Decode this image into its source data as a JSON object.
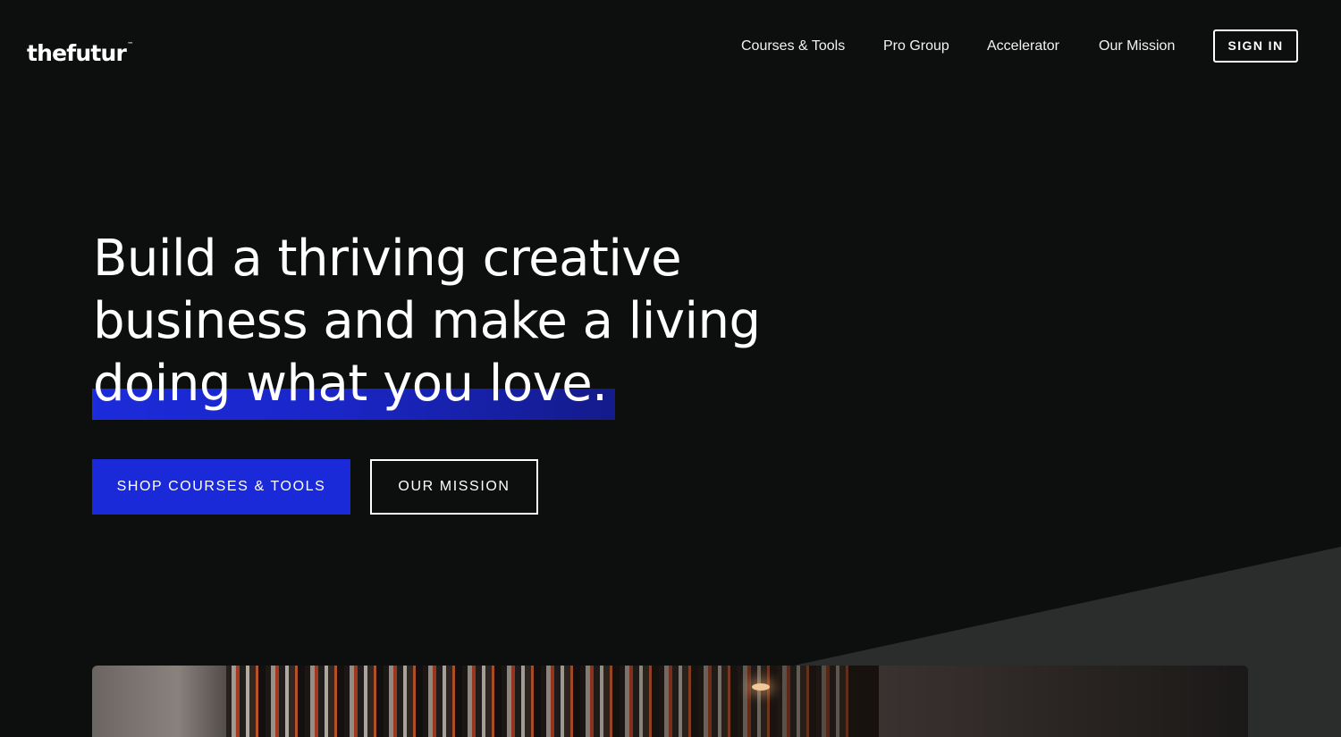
{
  "header": {
    "logo_text": "thefutur",
    "logo_mark": "™",
    "nav": [
      {
        "label": "Courses & Tools"
      },
      {
        "label": "Pro Group"
      },
      {
        "label": "Accelerator"
      },
      {
        "label": "Our Mission"
      }
    ],
    "sign_in_label": "SIGN IN"
  },
  "hero": {
    "headline_lines": [
      "Build a thriving creative",
      "business and make a living",
      "doing what you love."
    ],
    "primary_cta": "SHOP COURSES & TOOLS",
    "secondary_cta": "OUR MISSION"
  },
  "colors": {
    "background": "#0d0f0f",
    "accent": "#1b2ad8",
    "text": "#ffffff"
  }
}
